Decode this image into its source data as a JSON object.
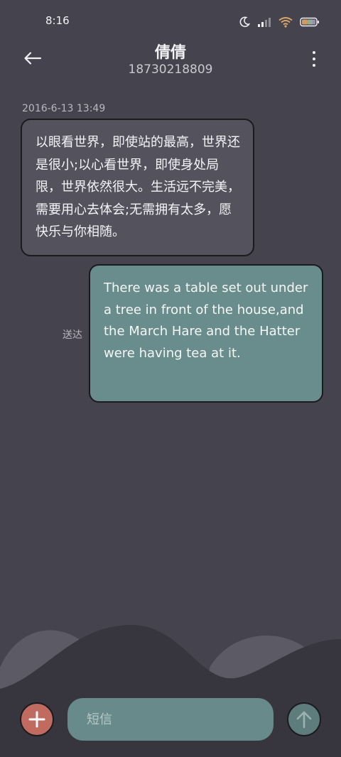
{
  "status_bar": {
    "time": "8:16",
    "icons": [
      "moon-icon",
      "signal-icon",
      "wifi-icon",
      "battery-icon"
    ]
  },
  "header": {
    "back_icon": "back-arrow-icon",
    "contact_name": "倩倩",
    "contact_number": "18730218809",
    "more_icon": "more-vertical-icon"
  },
  "conversation": {
    "timestamp": "2016-6-13 13:49",
    "messages": [
      {
        "direction": "incoming",
        "text": "以眼看世界，即使站的最高，世界还是很小;以心看世界，即使身处局限，世界依然很大。生活远不完美，需要用心去体会;无需拥有太多，愿快乐与你相随。"
      },
      {
        "direction": "outgoing",
        "status": "送达",
        "text": "There was a table set out under a tree in front of the house,and the March Hare and the Hatter were having tea at it."
      }
    ]
  },
  "composer": {
    "add_icon": "plus-icon",
    "placeholder": "短信",
    "value": "",
    "send_icon": "send-arrow-up-icon"
  },
  "colors": {
    "background": "#45434e",
    "incoming_bubble": "#54535d",
    "outgoing_bubble": "#698c8c",
    "add_button": "#c06a60",
    "input_bg": "#688a8a",
    "send_button": "#5f7c7d"
  }
}
